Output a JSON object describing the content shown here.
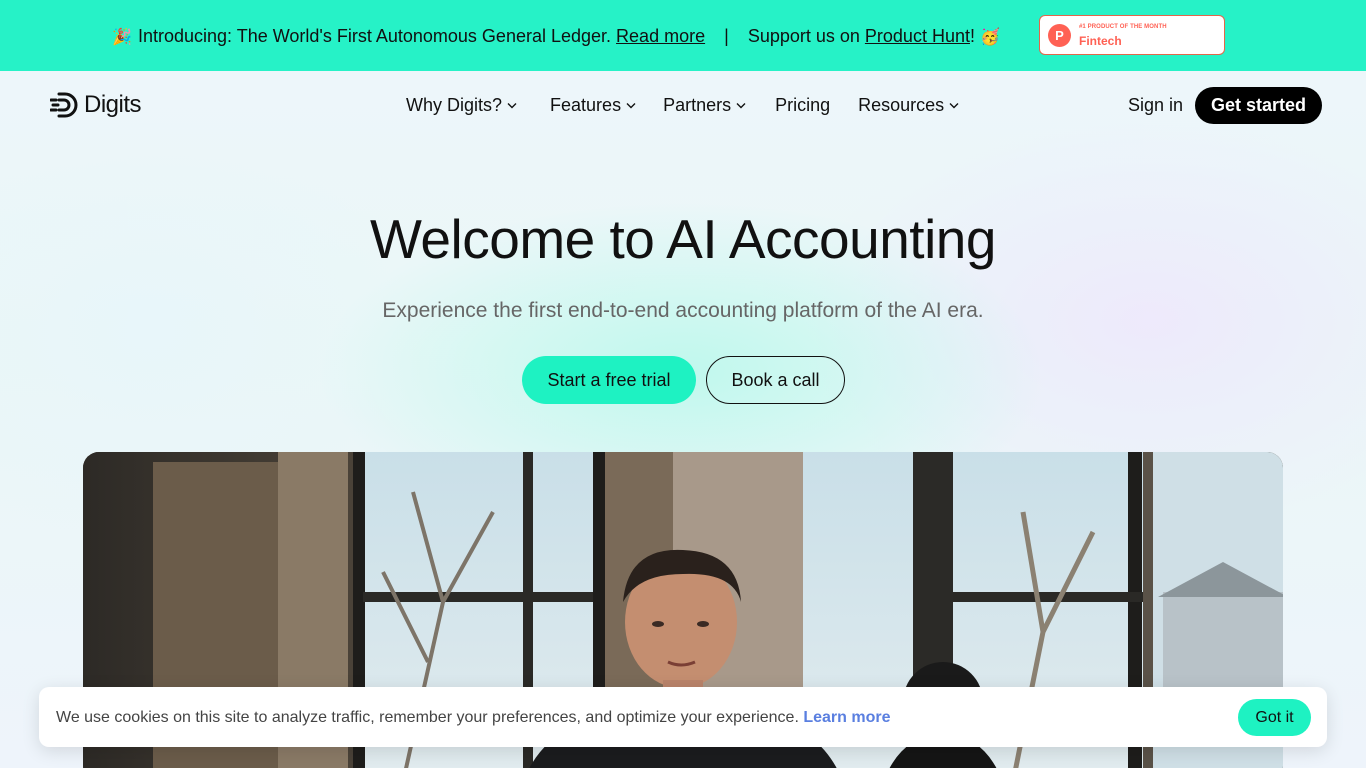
{
  "announcement": {
    "emoji_left": "🎉",
    "intro": "Introducing: The World's First Autonomous General Ledger.",
    "read_more": "Read more",
    "separator": "|",
    "support_prefix": "Support us on",
    "product_hunt": "Product Hunt",
    "support_suffix": "!",
    "emoji_right": "🥳",
    "badge": {
      "logo_letter": "P",
      "small_text": "#1 PRODUCT OF THE MONTH",
      "big_text": "Fintech"
    }
  },
  "nav": {
    "brand": "Digits",
    "links": [
      {
        "label": "Why Digits?",
        "dropdown": true
      },
      {
        "label": "Features",
        "dropdown": true
      },
      {
        "label": "Partners",
        "dropdown": true
      },
      {
        "label": "Pricing",
        "dropdown": false
      },
      {
        "label": "Resources",
        "dropdown": true
      }
    ],
    "sign_in": "Sign in",
    "get_started": "Get started"
  },
  "hero": {
    "title": "Welcome to AI Accounting",
    "subtitle": "Experience the first end-to-end accounting platform of the AI era.",
    "primary_cta": "Start a free trial",
    "secondary_cta": "Book a call"
  },
  "cookie": {
    "text": "We use cookies on this site to analyze traffic, remember your preferences, and optimize your experience.",
    "link": "Learn more",
    "button": "Got it"
  },
  "colors": {
    "accent": "#1ef2c2",
    "announce_bg": "#26f2c7",
    "product_hunt": "#ff6154",
    "cookie_link": "#5a7fe0"
  }
}
